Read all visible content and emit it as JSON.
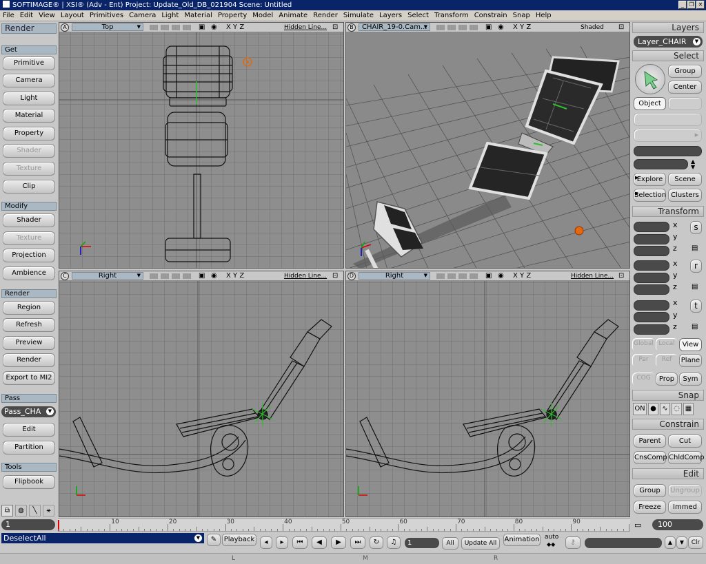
{
  "window": {
    "title": "SOFTIMAGE® | XSI® (Adv - Ent) Project: Update_Old_DB_021904    Scene: Untitled"
  },
  "menu": [
    "File",
    "Edit",
    "View",
    "Layout",
    "Primitives",
    "Camera",
    "Light",
    "Material",
    "Property",
    "Model",
    "Animate",
    "Render",
    "Simulate",
    "Layers",
    "Select",
    "Transform",
    "Constrain",
    "Snap",
    "Help"
  ],
  "left_panel": {
    "header": "Render",
    "get": {
      "title": "Get",
      "items": [
        "Primitive",
        "Camera",
        "Light",
        "Material",
        "Property",
        "Shader",
        "Texture",
        "Clip"
      ]
    },
    "modify": {
      "title": "Modify",
      "items": [
        "Shader",
        "Texture",
        "Projection",
        "Ambience"
      ]
    },
    "render": {
      "title": "Render",
      "items": [
        "Region",
        "Refresh",
        "Preview",
        "Render",
        "Export to MI2"
      ]
    },
    "pass": {
      "title": "Pass",
      "current": "Pass_CHA",
      "items": [
        "Edit",
        "Partition"
      ]
    },
    "tools": {
      "title": "Tools",
      "items": [
        "Flipbook"
      ]
    }
  },
  "viewports": {
    "a": {
      "letter": "A",
      "name": "Top",
      "axes": "X Y Z",
      "mode": "Hidden Line..."
    },
    "b": {
      "letter": "B",
      "name": "CHAIR_19-0.Cam...",
      "axes": "X Y Z",
      "mode": "Shaded"
    },
    "c": {
      "letter": "C",
      "name": "Right",
      "axes": "X Y Z",
      "mode": "Hidden Line..."
    },
    "d": {
      "letter": "D",
      "name": "Right",
      "axes": "X Y Z",
      "mode": "Hidden Line..."
    }
  },
  "right_panel": {
    "layers": {
      "title": "Layers",
      "current": "Layer_CHAIR"
    },
    "select": {
      "title": "Select",
      "group": "Group",
      "center": "Center",
      "object": "Object",
      "explore": "Explore",
      "scene": "Scene",
      "selection": "Selection",
      "clusters": "Clusters"
    },
    "transform": {
      "title": "Transform",
      "x": "x",
      "y": "y",
      "z": "z",
      "s": "s",
      "r": "r",
      "t": "t",
      "global": "Global",
      "local": "Local",
      "view": "View",
      "par": "Par",
      "ref": "Ref",
      "plane": "Plane",
      "cog": "COG",
      "prop": "Prop",
      "sym": "Sym"
    },
    "snap": {
      "title": "Snap",
      "on": "ON"
    },
    "constrain": {
      "title": "Constrain",
      "parent": "Parent",
      "cut": "Cut",
      "cnscomp": "CnsComp",
      "chldcomp": "ChldComp"
    },
    "edit": {
      "title": "Edit",
      "group": "Group",
      "ungroup": "Ungroup",
      "freeze": "Freeze",
      "immed": "Immed"
    }
  },
  "timeline": {
    "start": "1",
    "end": "100",
    "ticks": [
      "10",
      "20",
      "30",
      "40",
      "50",
      "60",
      "70",
      "80",
      "90"
    ]
  },
  "bottom": {
    "command": "DeselectAll",
    "playback": "Playback",
    "frame": "1",
    "all": "All",
    "update_all": "Update All",
    "animation": "Animation",
    "auto": "auto",
    "clr": "Clr",
    "lmr": [
      "L",
      "M",
      "R"
    ]
  },
  "colors": {
    "grid_bg": "#8e8e8e",
    "grid_line": "#6a6a6a",
    "shaded_bg": "#8a8a8a",
    "selection_green": "#2fbf2f",
    "light_orange": "#e06a10",
    "title_blue": "#0a246a"
  }
}
